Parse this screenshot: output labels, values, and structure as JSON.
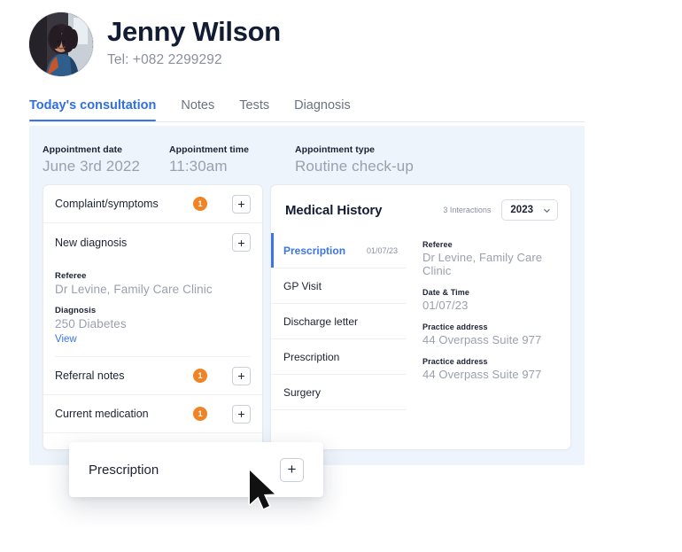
{
  "patient": {
    "name": "Jenny Wilson",
    "tel": "Tel: +082 2299292",
    "avatar_icon": "patient-photo"
  },
  "tabs": [
    {
      "label": "Today's consultation",
      "active": true
    },
    {
      "label": "Notes",
      "active": false
    },
    {
      "label": "Tests",
      "active": false
    },
    {
      "label": "Diagnosis",
      "active": false
    }
  ],
  "appointment": {
    "date_label": "Appointment date",
    "date_value": "June 3rd 2022",
    "time_label": "Appointment time",
    "time_value": "11:30am",
    "type_label": "Appointment type",
    "type_value": "Routine check-up"
  },
  "consultation": {
    "rows": [
      {
        "title": "Complaint/symptoms",
        "badge": "1",
        "add": "+"
      },
      {
        "title": "New diagnosis",
        "badge": "",
        "add": "+"
      },
      {
        "title": "Referral notes",
        "badge": "1",
        "add": "+"
      },
      {
        "title": "Current medication",
        "badge": "1",
        "add": "+"
      }
    ],
    "details": [
      {
        "label": "Referee",
        "value": "Dr Levine, Family Care Clinic"
      },
      {
        "label": "Diagnosis",
        "value": "250 Diabetes"
      }
    ],
    "view_link": "View"
  },
  "medical_history": {
    "title": "Medical History",
    "interactions": "3 Interactions",
    "year": "2023",
    "chevron_icon": "chevron-down-icon",
    "items": [
      {
        "label": "Prescription",
        "date": "01/07/23",
        "active": true
      },
      {
        "label": "GP Visit",
        "date": "",
        "active": false
      },
      {
        "label": "Discharge letter",
        "date": "",
        "active": false
      },
      {
        "label": "Prescription",
        "date": "",
        "active": false
      },
      {
        "label": "Surgery",
        "date": "",
        "active": false
      }
    ],
    "details": [
      {
        "label": "Referee",
        "value": "Dr Levine, Family Care Clinic"
      },
      {
        "label": "Date & Time",
        "value": "01/07/23"
      },
      {
        "label": "Practice address",
        "value": "44 Overpass Suite 977"
      },
      {
        "label": "Practice address",
        "value": "44 Overpass Suite 977"
      }
    ]
  },
  "floating_card": {
    "title": "Prescription",
    "add": "+"
  },
  "colors": {
    "accent_blue": "#3b74e8",
    "badge_orange": "#ef8325",
    "panel_bg": "#eef4fb",
    "text_dark": "#121c33",
    "text_muted": "#9aa0ad"
  }
}
